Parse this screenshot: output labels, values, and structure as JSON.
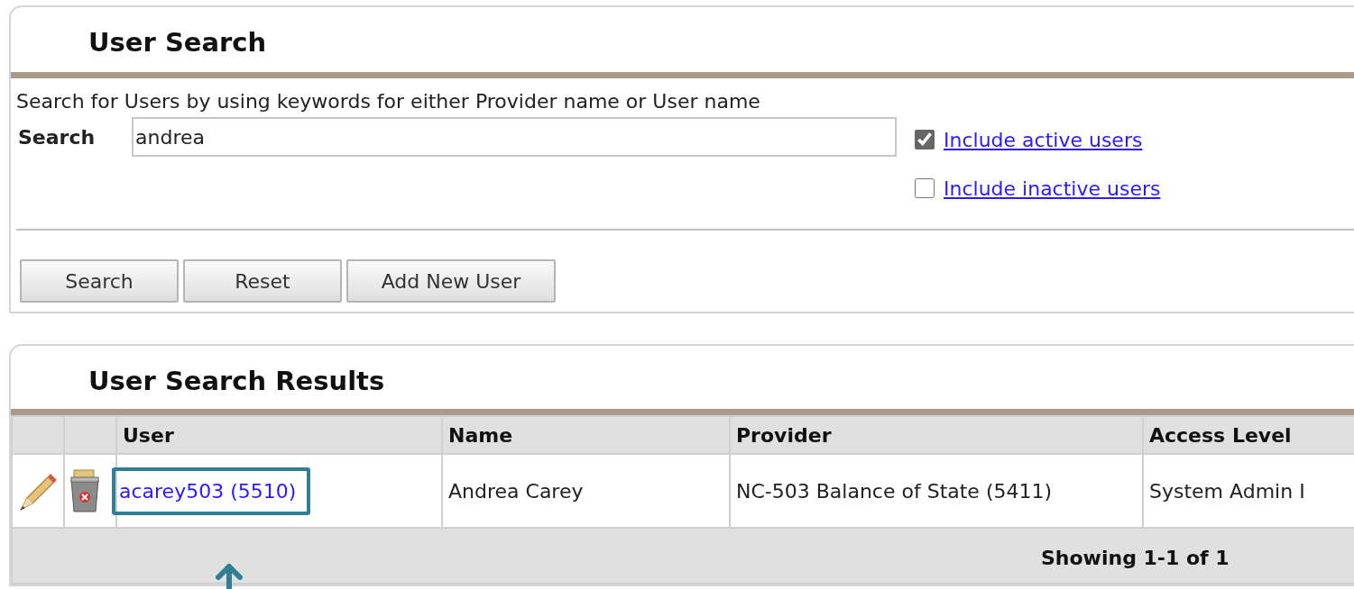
{
  "search_panel": {
    "title": "User Search",
    "description": "Search for Users by using keywords for either Provider name or User name",
    "search_label": "Search",
    "search_value": "andrea",
    "options": [
      {
        "label": "Include active users",
        "checked": true
      },
      {
        "label": "Include inactive users",
        "checked": false
      }
    ],
    "buttons": [
      "Search",
      "Reset",
      "Add New User"
    ]
  },
  "results_panel": {
    "title": "User Search Results",
    "columns": [
      "User",
      "Name",
      "Provider",
      "Access Level"
    ],
    "rows": [
      {
        "user": "acarey503 (5510)",
        "name": "Andrea Carey",
        "provider": "NC-503 Balance of State (5411)",
        "access_level": "System Admin I",
        "highlighted": true
      }
    ],
    "footer": "Showing 1-1 of 1"
  }
}
